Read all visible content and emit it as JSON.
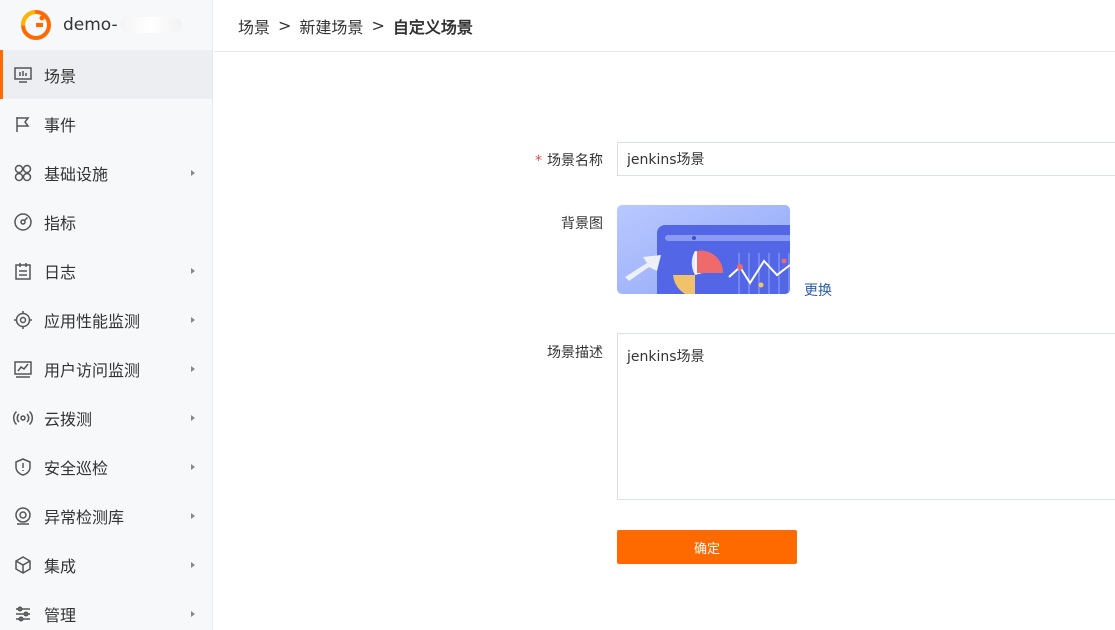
{
  "brand": {
    "name": "demo-",
    "logo_icon": "logo-g-icon",
    "accent_color": "#ff6a00"
  },
  "sidebar": {
    "items": [
      {
        "label": "场景",
        "icon": "monitor-icon",
        "active": true,
        "has_children": false
      },
      {
        "label": "事件",
        "icon": "flag-icon",
        "active": false,
        "has_children": false
      },
      {
        "label": "基础设施",
        "icon": "grid-circles-icon",
        "active": false,
        "has_children": true
      },
      {
        "label": "指标",
        "icon": "gauge-icon",
        "active": false,
        "has_children": false
      },
      {
        "label": "日志",
        "icon": "log-icon",
        "active": false,
        "has_children": true
      },
      {
        "label": "应用性能监测",
        "icon": "target-icon",
        "active": false,
        "has_children": true
      },
      {
        "label": "用户访问监测",
        "icon": "chart-monitor-icon",
        "active": false,
        "has_children": true
      },
      {
        "label": "云拨测",
        "icon": "broadcast-icon",
        "active": false,
        "has_children": true
      },
      {
        "label": "安全巡检",
        "icon": "shield-icon",
        "active": false,
        "has_children": true
      },
      {
        "label": "异常检测库",
        "icon": "anomaly-icon",
        "active": false,
        "has_children": true
      },
      {
        "label": "集成",
        "icon": "cube-icon",
        "active": false,
        "has_children": true
      },
      {
        "label": "管理",
        "icon": "sliders-icon",
        "active": false,
        "has_children": true
      }
    ]
  },
  "breadcrumb": {
    "items": [
      "场景",
      "新建场景",
      "自定义场景"
    ],
    "separator": ">"
  },
  "form": {
    "name_label": "场景名称",
    "required_mark": "*",
    "name_value": "jenkins场景",
    "bg_label": "背景图",
    "change_label": "更换",
    "desc_label": "场景描述",
    "desc_value": "jenkins场景",
    "confirm_label": "确定"
  }
}
